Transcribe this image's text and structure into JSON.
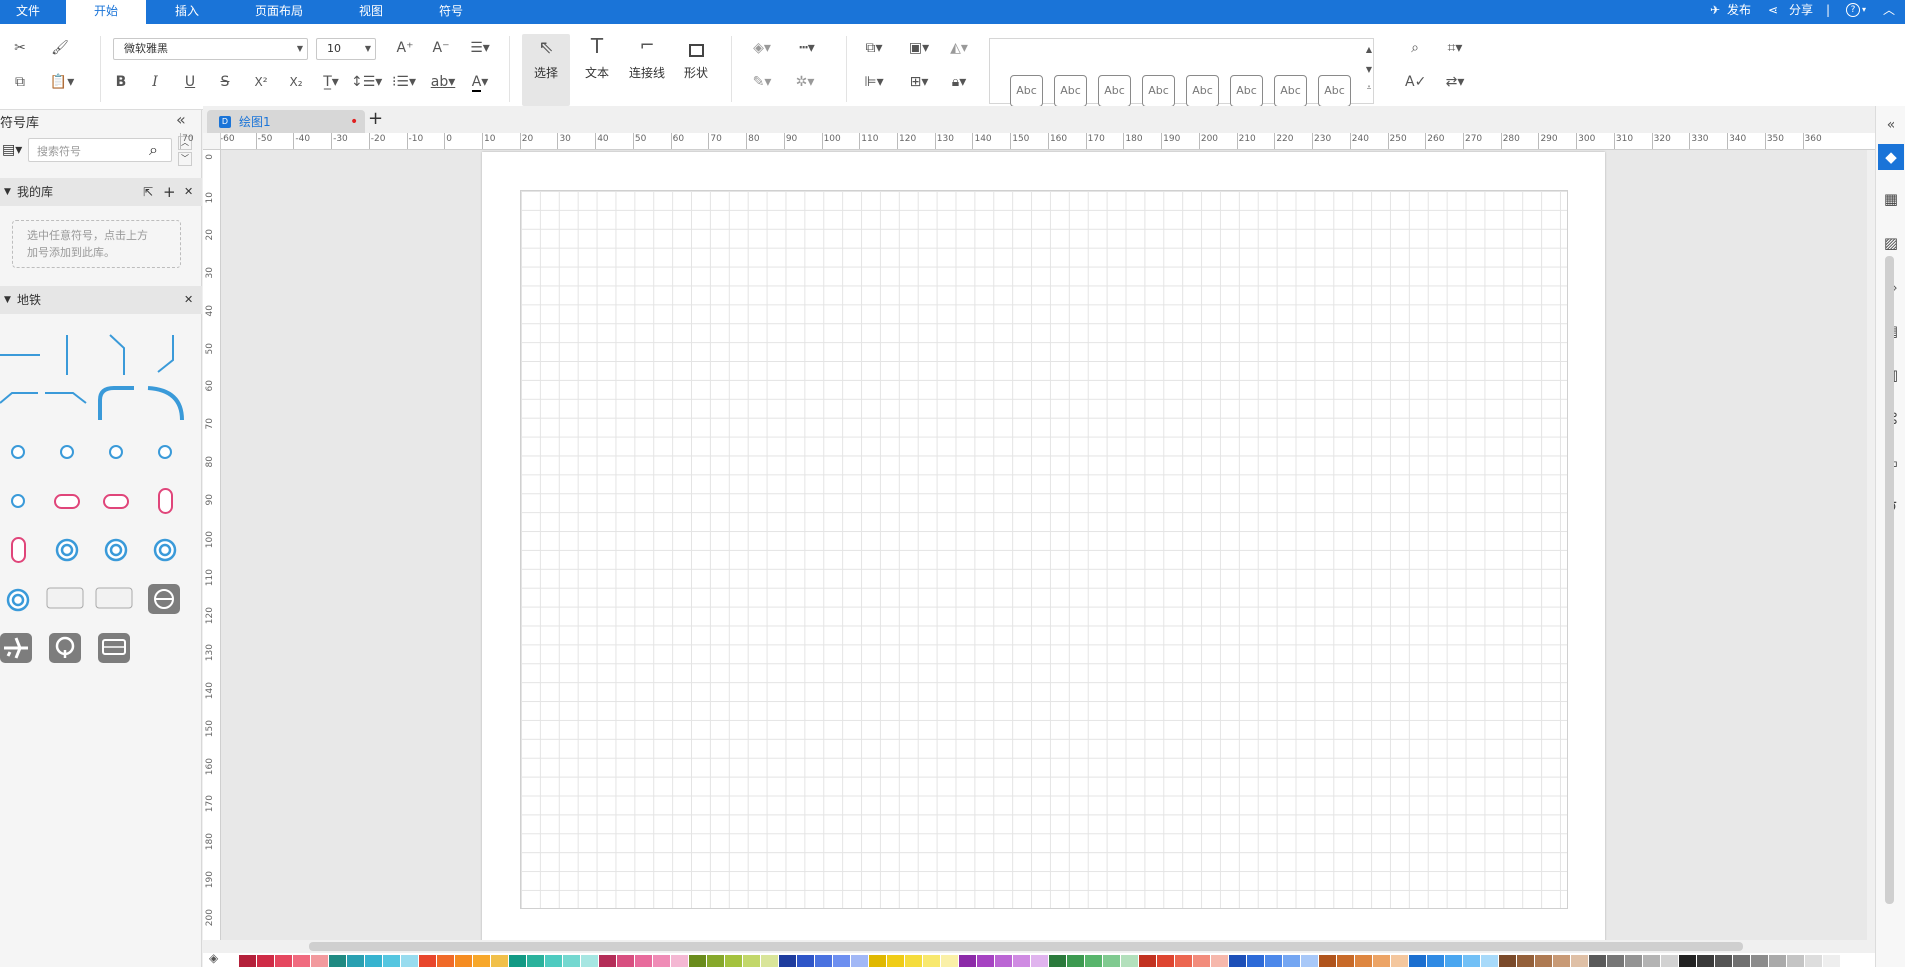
{
  "menubar": {
    "tabs": [
      {
        "label": "文件"
      },
      {
        "label": "开始"
      },
      {
        "label": "插入"
      },
      {
        "label": "页面布局"
      },
      {
        "label": "视图"
      },
      {
        "label": "符号"
      }
    ],
    "active_tab": "开始",
    "publish": "发布",
    "share": "分享",
    "separator": "|",
    "help": "?"
  },
  "ribbon": {
    "font_family": "微软雅黑",
    "font_size": "10",
    "select": "选择",
    "text": "文本",
    "connector": "连接线",
    "shape": "形状",
    "style_samples": [
      "Abc",
      "Abc",
      "Abc",
      "Abc",
      "Abc",
      "Abc",
      "Abc",
      "Abc"
    ]
  },
  "left_panel": {
    "title": "符号库",
    "search_placeholder": "搜索符号",
    "my_library": {
      "title": "我的库",
      "hint_line1": "选中任意符号，点击上方",
      "hint_line2": "加号添加到此库。"
    },
    "metro": {
      "title": "地铁"
    }
  },
  "document": {
    "tab_title": "绘图1",
    "add_tab": "+"
  },
  "rulers": {
    "h_labels": [
      "70",
      "-60",
      "-50",
      "-40",
      "-30",
      "-20",
      "-10",
      "0",
      "10",
      "20",
      "30",
      "40",
      "50",
      "60",
      "70",
      "80",
      "90",
      "100",
      "110",
      "120",
      "130",
      "140",
      "150",
      "160",
      "170",
      "180",
      "190",
      "200",
      "210",
      "220",
      "230",
      "240",
      "250",
      "260",
      "270",
      "280",
      "290",
      "300",
      "310",
      "320",
      "330",
      "340",
      "350",
      "360"
    ],
    "v_labels": [
      "0",
      "10",
      "20",
      "30",
      "40",
      "50",
      "60",
      "70",
      "80",
      "90",
      "100",
      "110",
      "120",
      "130",
      "140",
      "150",
      "160",
      "170",
      "180",
      "190",
      "200"
    ]
  },
  "colors": {
    "accent": "#1a74d8",
    "palette": [
      "#b4203a",
      "#cf2b46",
      "#e5475f",
      "#f06b7f",
      "#f29a9e",
      "#1f8a82",
      "#29a0b1",
      "#36b3cf",
      "#55c6e0",
      "#98dcef",
      "#e8462c",
      "#f06a28",
      "#f58c21",
      "#f7a72a",
      "#f1c04a",
      "#129a84",
      "#2ab29c",
      "#4ecbc0",
      "#74d8d0",
      "#a6e6e2",
      "#b42d58",
      "#d84f80",
      "#e86b9c",
      "#ef8cb6",
      "#f4b8d3",
      "#6a8c1c",
      "#86a82b",
      "#a4c23e",
      "#c2d76a",
      "#d9e59a",
      "#1e3c9e",
      "#2e55c8",
      "#4a72e0",
      "#6d8ff0",
      "#a2b8f6",
      "#e0b800",
      "#f0cc16",
      "#f5dc3c",
      "#f8e86e",
      "#faf0a8",
      "#8c2aa8",
      "#a643c2",
      "#bb66d4",
      "#cf8be2",
      "#e0b4ee",
      "#2b7a3c",
      "#3c9a50",
      "#58b56c",
      "#80ca90",
      "#b3e0bc",
      "#c23220",
      "#de4530",
      "#ec6650",
      "#f28c7c",
      "#f6b8ac",
      "#1c4fb8",
      "#2c6ad8",
      "#4c88ea",
      "#74a6f2",
      "#a8c8f8",
      "#b0541c",
      "#c86a28",
      "#de8640",
      "#eca466",
      "#f4c79e",
      "#1b6fd0",
      "#2f8ae4",
      "#4aa6f0",
      "#72c0f6",
      "#a8dafa",
      "#7a4a2a",
      "#94603a",
      "#ae7a52",
      "#c89a76",
      "#dfc0a6",
      "#5a5a5a",
      "#777777",
      "#949494",
      "#b3b3b3",
      "#d2d2d2",
      "#222222",
      "#3a3a3a",
      "#555555",
      "#707070",
      "#8c8c8c",
      "#aaaaaa",
      "#c4c4c4",
      "#dddddd",
      "#eeeeee",
      "#ffffff"
    ]
  }
}
